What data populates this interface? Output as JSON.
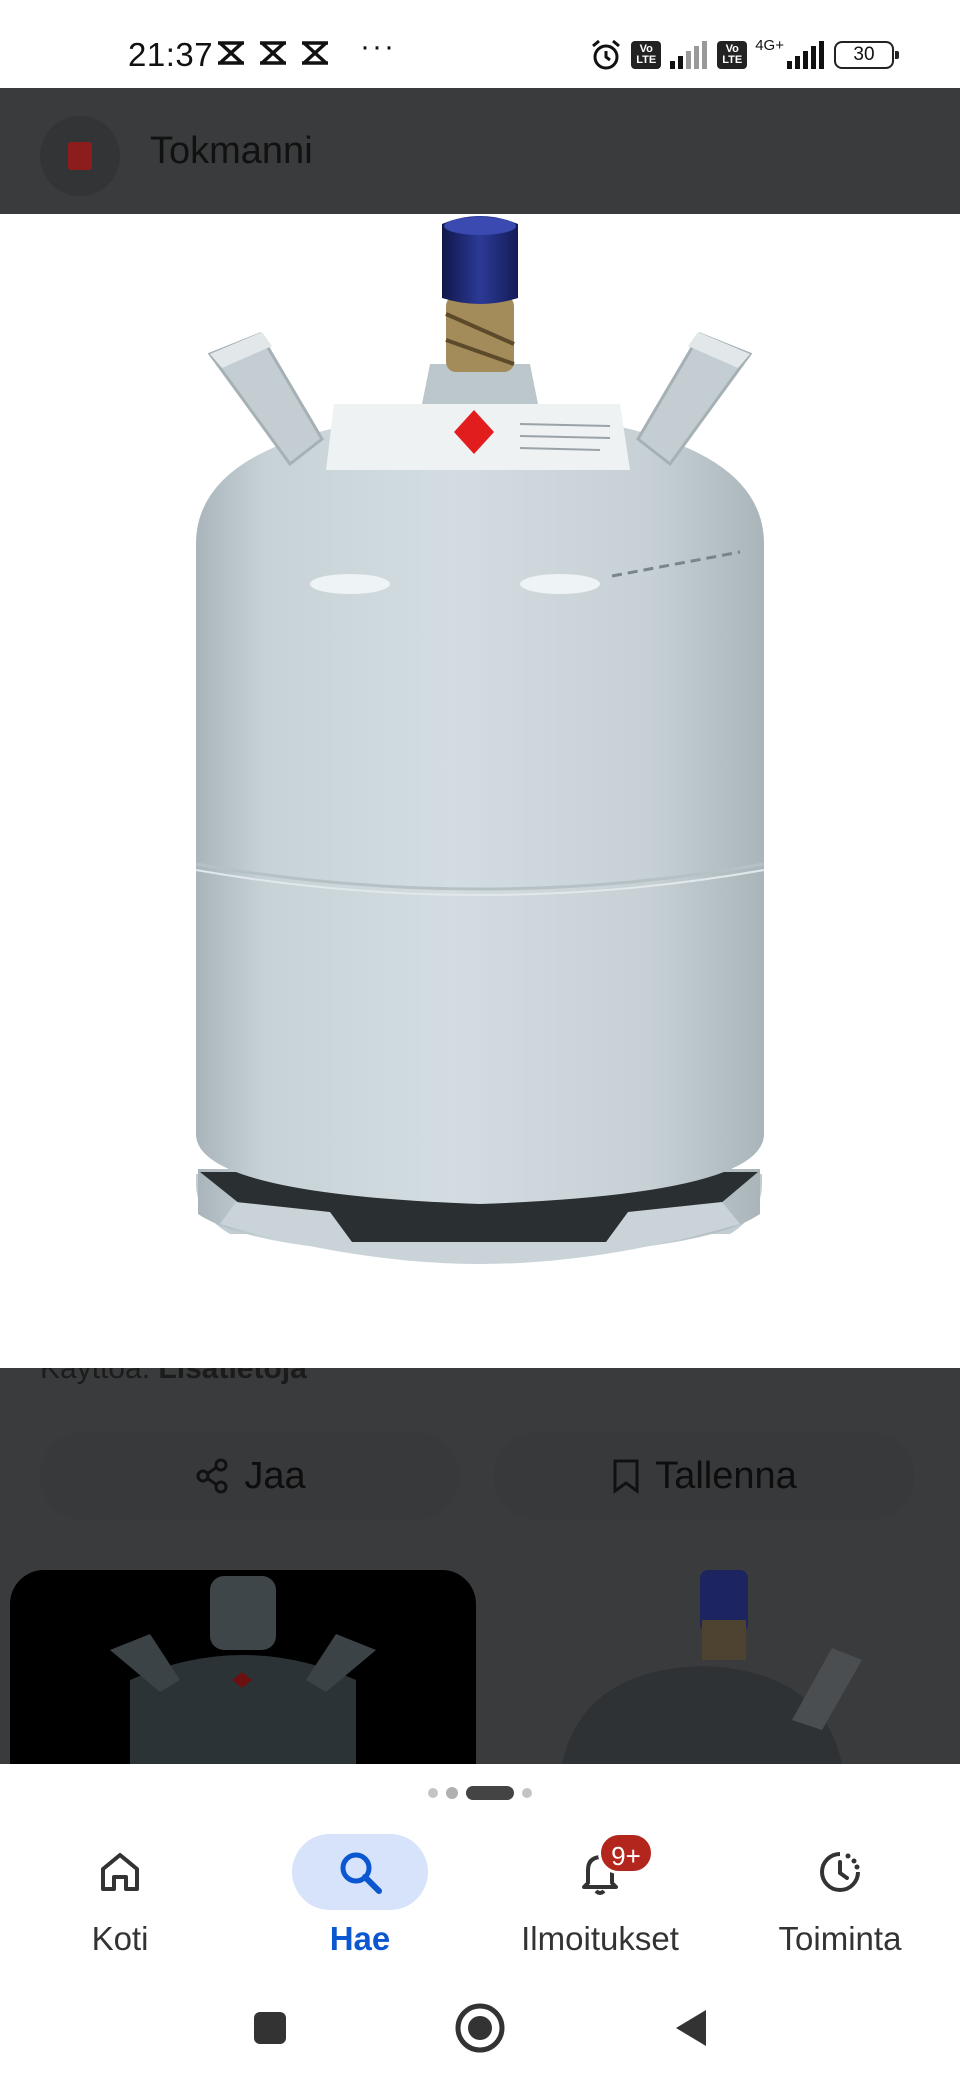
{
  "status_bar": {
    "time": "21:37",
    "more": "···",
    "volte_label": "Vo LTE",
    "network_type": "4G+",
    "battery": "30",
    "icons": [
      "x-notification-icon",
      "x-notification-icon",
      "x-notification-icon",
      "alarm-icon",
      "signal-icon",
      "signal-icon",
      "battery-icon"
    ]
  },
  "site": {
    "name": "Tokmanni"
  },
  "caption": {
    "prefix": "Käyttöä.",
    "link": "Lisätietoja"
  },
  "actions": {
    "share_label": "Jaa",
    "save_label": "Tallenna"
  },
  "pager": {
    "count": 4,
    "active_index": 2
  },
  "bottom_nav": {
    "items": [
      {
        "label": "Koti",
        "icon": "home-icon"
      },
      {
        "label": "Hae",
        "icon": "search-icon"
      },
      {
        "label": "Ilmoitukset",
        "icon": "bell-icon",
        "badge": "9+"
      },
      {
        "label": "Toiminta",
        "icon": "activity-icon"
      }
    ],
    "active_index": 1
  },
  "system_nav": [
    "recents-icon",
    "home-circle-icon",
    "back-icon"
  ],
  "colors": {
    "accent": "#0b57d0",
    "active_pill": "#d6e3fb",
    "badge": "#b3261e",
    "scrim_page": "#3a3b3c",
    "cylinder": "#c9d3d8",
    "valve_cap": "#1f2d7a",
    "hazard_diamond": "#e21d1d"
  }
}
